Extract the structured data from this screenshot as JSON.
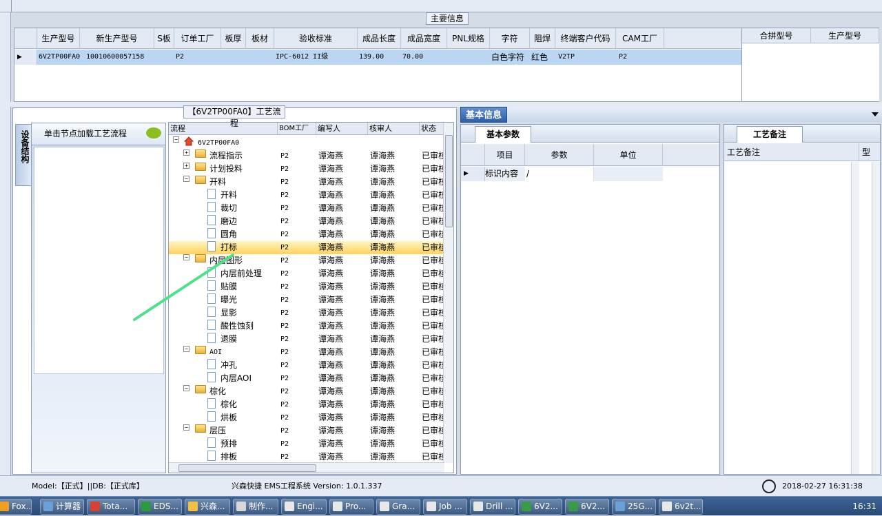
{
  "main_info": {
    "legend": "主要信息",
    "columns": [
      "生产型号",
      "新生产型号",
      "S板",
      "订单工厂",
      "板厚",
      "板材",
      "验收标准",
      "成品长度",
      "成品宽度",
      "PNL规格",
      "字符",
      "阻焊",
      "终端客户代码",
      "CAM工厂"
    ],
    "row": [
      "6V2TP00FA0",
      "10010600057158",
      "",
      "P2",
      "",
      "",
      "IPC-6012 II级",
      "139.00",
      "70.00",
      "",
      "白色字符",
      "红色",
      "V2TP",
      "P2"
    ],
    "side_columns": [
      "合拼型号",
      "生产型号"
    ]
  },
  "flow": {
    "legend": "【6V2TP00FA0】工艺流程",
    "vertical_tab": "设备结构",
    "hint": "单击节点加载工艺流程",
    "columns": [
      "流程",
      "BOM工厂",
      "编写人",
      "核审人",
      "状态"
    ],
    "rows": [
      {
        "name": "6V2TP00FA0",
        "bom": "",
        "writer": "",
        "reviewer": "",
        "status": ""
      },
      {
        "name": "流程指示",
        "bom": "P2",
        "writer": "谭海燕",
        "reviewer": "谭海燕",
        "status": "已审核"
      },
      {
        "name": "计划投料",
        "bom": "P2",
        "writer": "谭海燕",
        "reviewer": "谭海燕",
        "status": "已审核"
      },
      {
        "name": "开料",
        "bom": "P2",
        "writer": "谭海燕",
        "reviewer": "谭海燕",
        "status": "已审核"
      },
      {
        "name": "开料",
        "bom": "P2",
        "writer": "谭海燕",
        "reviewer": "谭海燕",
        "status": "已审核"
      },
      {
        "name": "裁切",
        "bom": "P2",
        "writer": "谭海燕",
        "reviewer": "谭海燕",
        "status": "已审核"
      },
      {
        "name": "磨边",
        "bom": "P2",
        "writer": "谭海燕",
        "reviewer": "谭海燕",
        "status": "已审核"
      },
      {
        "name": "圆角",
        "bom": "P2",
        "writer": "谭海燕",
        "reviewer": "谭海燕",
        "status": "已审核"
      },
      {
        "name": "打标",
        "bom": "P2",
        "writer": "谭海燕",
        "reviewer": "谭海燕",
        "status": "已审核"
      },
      {
        "name": "内层图形",
        "bom": "P2",
        "writer": "谭海燕",
        "reviewer": "谭海燕",
        "status": "已审核"
      },
      {
        "name": "内层前处理",
        "bom": "P2",
        "writer": "谭海燕",
        "reviewer": "谭海燕",
        "status": "已审核"
      },
      {
        "name": "贴膜",
        "bom": "P2",
        "writer": "谭海燕",
        "reviewer": "谭海燕",
        "status": "已审核"
      },
      {
        "name": "曝光",
        "bom": "P2",
        "writer": "谭海燕",
        "reviewer": "谭海燕",
        "status": "已审核"
      },
      {
        "name": "显影",
        "bom": "P2",
        "writer": "谭海燕",
        "reviewer": "谭海燕",
        "status": "已审核"
      },
      {
        "name": "酸性蚀刻",
        "bom": "P2",
        "writer": "谭海燕",
        "reviewer": "谭海燕",
        "status": "已审核"
      },
      {
        "name": "退膜",
        "bom": "P2",
        "writer": "谭海燕",
        "reviewer": "谭海燕",
        "status": "已审核"
      },
      {
        "name": "AOI",
        "bom": "P2",
        "writer": "谭海燕",
        "reviewer": "谭海燕",
        "status": "已审核"
      },
      {
        "name": "冲孔",
        "bom": "P2",
        "writer": "谭海燕",
        "reviewer": "谭海燕",
        "status": "已审核"
      },
      {
        "name": "内层AOI",
        "bom": "P2",
        "writer": "谭海燕",
        "reviewer": "谭海燕",
        "status": "已审核"
      },
      {
        "name": "棕化",
        "bom": "P2",
        "writer": "谭海燕",
        "reviewer": "谭海燕",
        "status": "已审核"
      },
      {
        "name": "棕化",
        "bom": "P2",
        "writer": "谭海燕",
        "reviewer": "谭海燕",
        "status": "已审核"
      },
      {
        "name": "烘板",
        "bom": "P2",
        "writer": "谭海燕",
        "reviewer": "谭海燕",
        "status": "已审核"
      },
      {
        "name": "层压",
        "bom": "P2",
        "writer": "谭海燕",
        "reviewer": "谭海燕",
        "status": "已审核"
      },
      {
        "name": "预排",
        "bom": "P2",
        "writer": "谭海燕",
        "reviewer": "谭海燕",
        "status": "已审核"
      },
      {
        "name": "排板",
        "bom": "P2",
        "writer": "谭海燕",
        "reviewer": "谭海燕",
        "status": "已审核"
      }
    ]
  },
  "basic_info": {
    "header_tab": "基本信息",
    "params_tab": "基本参数",
    "columns": [
      "项目",
      "参数",
      "单位"
    ],
    "row": {
      "item": "标识内容",
      "param": "/",
      "unit": ""
    }
  },
  "notes": {
    "tab": "工艺备注",
    "columns": [
      "工艺备注",
      "型"
    ]
  },
  "status": {
    "model": "Model:【正式】||DB:【正式库】",
    "app": "兴森快捷 EMS工程系统 Version: 1.0.1.337",
    "datetime": "2018-02-27 16:31:38"
  },
  "taskbar": {
    "items": [
      "Fox...",
      "计算器",
      "Tota...",
      "EDS...",
      "兴森...",
      "制作...",
      "Engi...",
      "Pro...",
      "Gra...",
      "Job ...",
      "Drill ...",
      "6V2...",
      "6V2...",
      "25G...",
      "6v2t..."
    ],
    "clock": "16:31"
  },
  "colors": {
    "accent": "#2d5fa8",
    "selected_row": "#bad6f3",
    "tree_selection": "#ffd25e"
  }
}
